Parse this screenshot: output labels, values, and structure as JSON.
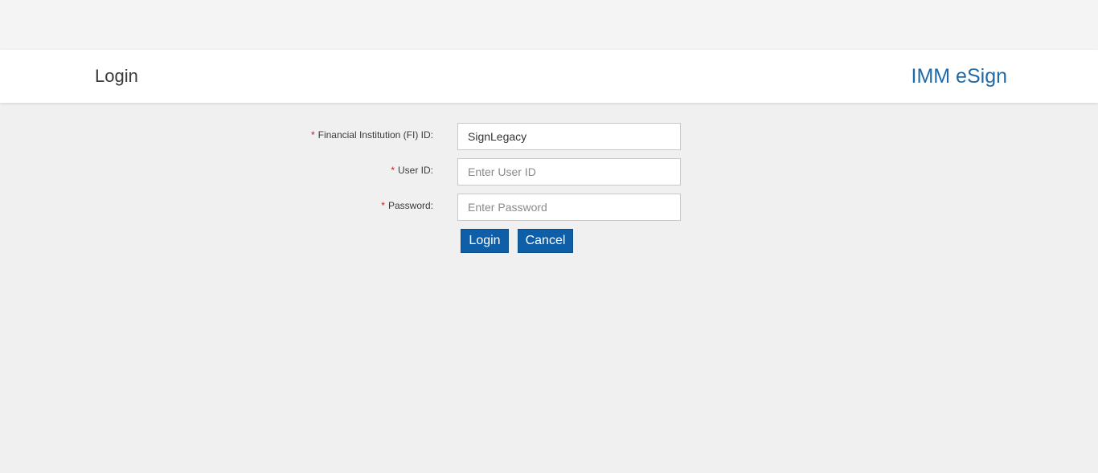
{
  "header": {
    "title": "Login",
    "brand": "IMM eSign"
  },
  "form": {
    "required_marker": "*",
    "fields": [
      {
        "label": "Financial Institution (FI) ID:",
        "value": "SignLegacy",
        "placeholder": ""
      },
      {
        "label": "User ID:",
        "value": "",
        "placeholder": "Enter User ID"
      },
      {
        "label": "Password:",
        "value": "",
        "placeholder": "Enter Password"
      }
    ],
    "login_label": "Login",
    "cancel_label": "Cancel"
  },
  "colors": {
    "brand": "#1f6aa8",
    "button": "#0f5ea8",
    "required": "#d9141c",
    "background": "#f0f0f0"
  }
}
